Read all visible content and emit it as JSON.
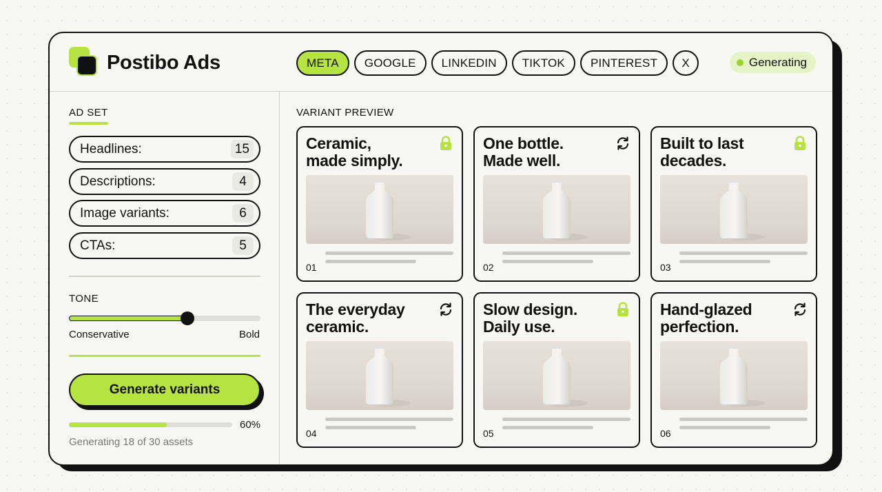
{
  "app": {
    "name": "Postibo Ads"
  },
  "tabs": [
    {
      "label": "META",
      "active": true
    },
    {
      "label": "GOOGLE",
      "active": false
    },
    {
      "label": "LINKEDIN",
      "active": false
    },
    {
      "label": "TIKTOK",
      "active": false
    },
    {
      "label": "PINTEREST",
      "active": false
    },
    {
      "label": "X",
      "active": false
    }
  ],
  "status": {
    "label": "Generating"
  },
  "sidebar": {
    "ad_set_label": "AD SET",
    "counts": [
      {
        "label": "Headlines:",
        "value": "15"
      },
      {
        "label": "Descriptions:",
        "value": "4"
      },
      {
        "label": "Image variants:",
        "value": "6"
      },
      {
        "label": "CTAs:",
        "value": "5"
      }
    ],
    "tone": {
      "label": "TONE",
      "min_label": "Conservative",
      "max_label": "Bold",
      "value": 0.62
    },
    "generate_label": "Generate variants",
    "progress": {
      "percent": 60,
      "percent_label": "60%",
      "text": "Generating 18 of 30 assets"
    }
  },
  "main": {
    "label": "VARIANT PREVIEW",
    "variants": [
      {
        "title_line1": "Ceramic,",
        "title_line2": "made simply.",
        "icon": "lock-icon",
        "number": "01"
      },
      {
        "title_line1": "One bottle.",
        "title_line2": "Made well.",
        "icon": "refresh-icon",
        "number": "02"
      },
      {
        "title_line1": "Built to last",
        "title_line2": "decades.",
        "icon": "lock-icon",
        "number": "03"
      },
      {
        "title_line1": "The everyday",
        "title_line2": "ceramic.",
        "icon": "refresh-icon",
        "number": "04"
      },
      {
        "title_line1": "Slow design.",
        "title_line2": "Daily use.",
        "icon": "lock-icon",
        "number": "05"
      },
      {
        "title_line1": "Hand-glazed",
        "title_line2": "perfection.",
        "icon": "refresh-icon",
        "number": "06"
      }
    ]
  },
  "colors": {
    "accent": "#b6e341",
    "ink": "#111111",
    "surface": "#f7f8f3"
  }
}
